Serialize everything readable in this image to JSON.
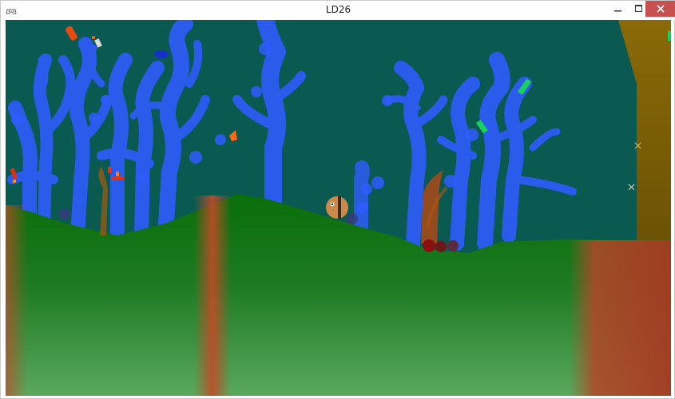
{
  "window": {
    "title": "LD26",
    "app_icon": "gamepad-icon",
    "controls": [
      "minimize-icon",
      "maximize-icon",
      "close-icon"
    ]
  },
  "scene": {
    "type": "2D underwater side-scroller",
    "colors": {
      "water": "#0a5a52",
      "coral": "#2f5cff",
      "ground": "#0a6e0a",
      "sand_bands": "#c24a28",
      "rock_wall": "#7a5a06",
      "player_fish": "#c98a4a",
      "close_button": "#c75050"
    }
  }
}
